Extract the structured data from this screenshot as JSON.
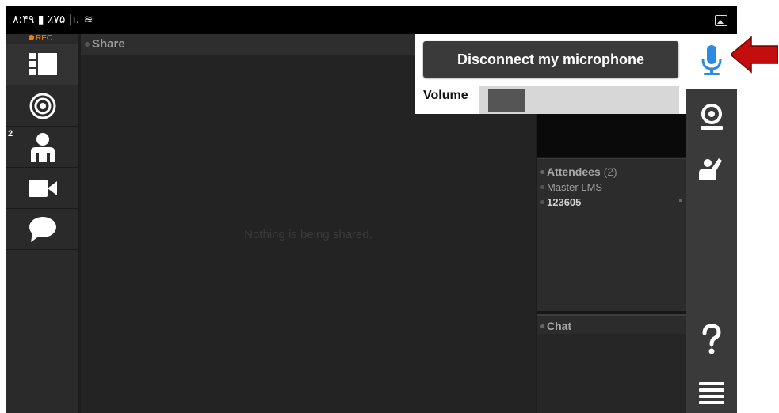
{
  "status_bar": {
    "text": "۸:۴۹ ▮ ٪۷۵ |ı. ≋"
  },
  "rec_label": "REC",
  "attendee_badge": "2",
  "share": {
    "title": "Share",
    "empty_message": "Nothing is being shared."
  },
  "popup": {
    "disconnect_label": "Disconnect my microphone",
    "volume_label": "Volume",
    "volume_level": 0.19
  },
  "attendees": {
    "title": "Attendees",
    "count": "(2)",
    "list": [
      "Master LMS",
      "123605"
    ]
  },
  "chat": {
    "title": "Chat"
  },
  "colors": {
    "mic_active": "#2c8be0",
    "arrow": "#c40d0d",
    "rec": "#f07d1a"
  },
  "icons": {
    "left_rail": [
      "layout-icon",
      "broadcast-icon",
      "attendee-icon",
      "video-camera-icon",
      "chat-bubble-icon"
    ],
    "right_rail": [
      "microphone-icon",
      "webcam-icon",
      "raise-hand-icon",
      "help-icon",
      "menu-icon"
    ]
  }
}
